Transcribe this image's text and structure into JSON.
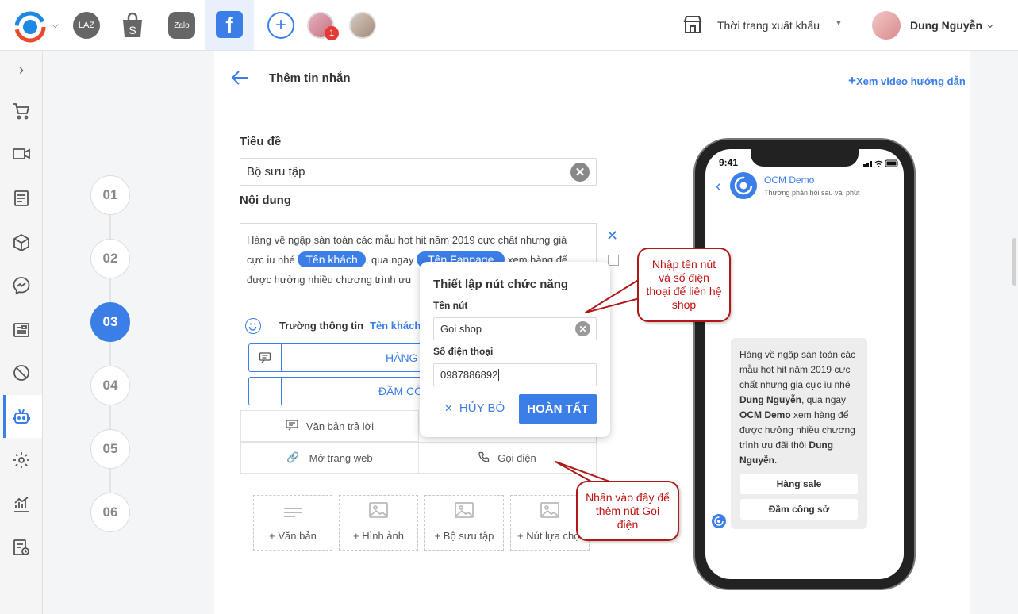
{
  "topbar": {
    "laz_label": "LAZ",
    "zalo_label": "Zalo",
    "notification_count": "1",
    "shop_name": "Thời trang xuất khẩu",
    "user_name": "Dung Nguyễn"
  },
  "header": {
    "title": "Thêm tin nhắn",
    "video_link": "Xem video hướng dẫn"
  },
  "steps": [
    "01",
    "02",
    "03",
    "04",
    "05",
    "06"
  ],
  "form": {
    "title_label": "Tiêu đề",
    "title_value": "Bộ sưu tập",
    "content_label": "Nội dung",
    "content_text_1": "Hàng về ngập sàn toàn các mẫu hot hit năm 2019 cực chất nhưng giá cực iu nhé",
    "tag_customer": "Tên khách",
    "content_text_2": ", qua ngay",
    "tag_fanpage": "Tên Fanpage",
    "content_text_3": "xem hàng để",
    "content_text_4": "được hưởng nhiều chương trình ưu",
    "field_info_label": "Trường thông tin",
    "field_customer_link": "Tên khách",
    "btn1_label": "HÀNG",
    "btn2_label": "ĐẦM CÔ",
    "action_reply": "Văn bản trả lời",
    "action_web": "Mở trang web",
    "action_call": "Gọi điện"
  },
  "add_cards": [
    "+ Văn bản",
    "+ Hình ảnh",
    "+ Bộ sưu tập",
    "+ Nút lựa chọn"
  ],
  "popup": {
    "title": "Thiết lập nút chức năng",
    "name_label": "Tên nút",
    "name_value": "Gọi shop",
    "phone_label": "Số điện thoại",
    "phone_value": "0987886892",
    "cancel": "HỦY BỎ",
    "done": "HOÀN TẤT"
  },
  "phone": {
    "time": "9:41",
    "page_name": "OCM Demo",
    "page_status": "Thường phản hồi sau vài phút",
    "msg_1": "Hàng về ngập sàn toàn các mẫu hot hit năm 2019 cực chất nhưng giá cực iu nhé ",
    "msg_name_1": "Dung Nguyễn",
    "msg_2": ", qua ngay ",
    "msg_page": "OCM Demo",
    "msg_3": " xem hàng để được hưởng nhiều chương trình ưu đãi thôi ",
    "msg_name_2": "Dung Nguyễn",
    "msg_4": ".",
    "btn_1": "Hàng sale",
    "btn_2": "Đầm công sở"
  },
  "callouts": {
    "top": "Nhập tên nút và số điện thoại để liên hệ shop",
    "bottom": "Nhấn vào đây để thêm nút Gọi điện"
  },
  "colors": {
    "accent": "#3b7ee8",
    "callout_red": "#b01818"
  }
}
